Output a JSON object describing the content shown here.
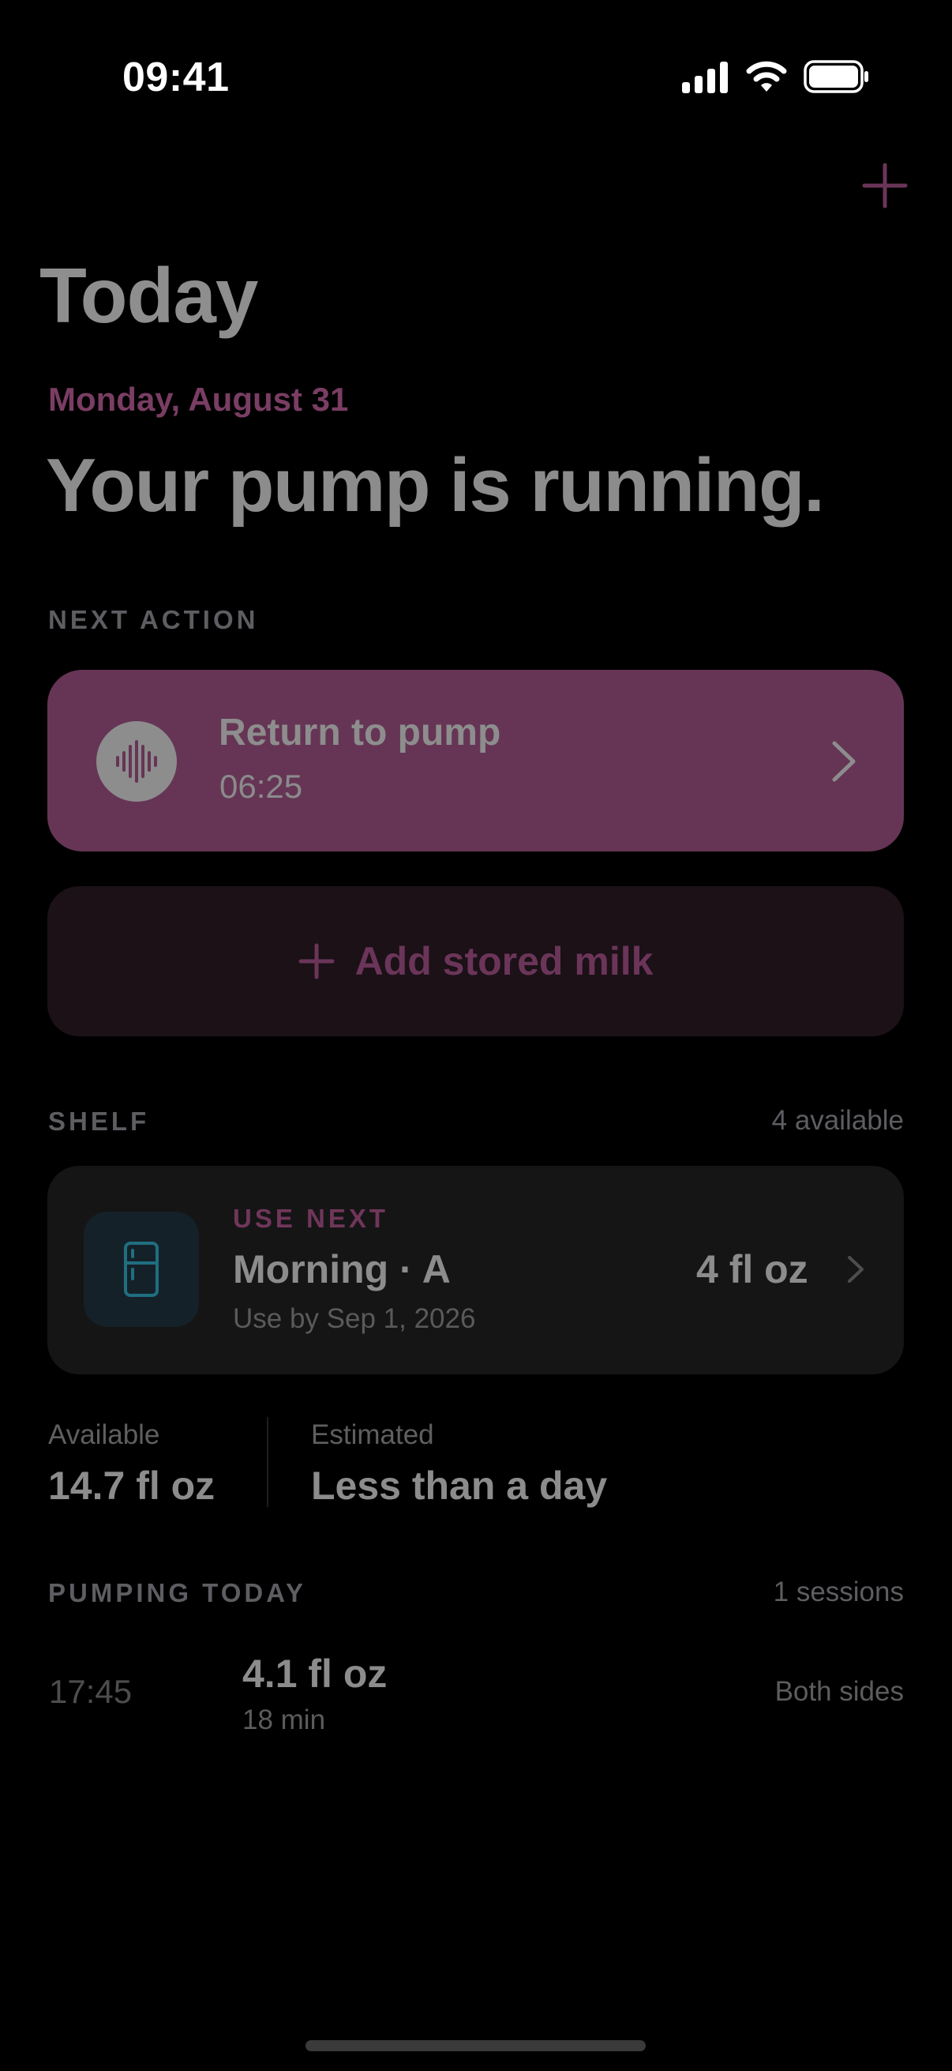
{
  "status_bar": {
    "time": "09:41",
    "icons": [
      "cellular-signal-icon",
      "wifi-icon",
      "battery-icon"
    ]
  },
  "nav": {
    "add_icon": "plus-icon",
    "large_title": "Today"
  },
  "header": {
    "date": "Monday, August 31",
    "headline": "Your pump is running."
  },
  "next_action": {
    "section_label": "NEXT ACTION",
    "card": {
      "icon": "waveform-icon",
      "title": "Return to pump",
      "subtitle": "06:25",
      "chevron": "chevron-right-icon"
    },
    "add_button": {
      "icon": "plus-icon",
      "label": "Add stored milk"
    }
  },
  "shelf": {
    "section_label": "SHELF",
    "count": "4 available",
    "item": {
      "icon": "refrigerator-icon",
      "badge": "USE NEXT",
      "title": "Morning · A",
      "subtitle": "Use by Sep 1, 2026",
      "amount": "4 fl oz",
      "chevron": "chevron-right-icon"
    }
  },
  "stats": {
    "available_label": "Available",
    "available_value": "14.7 fl oz",
    "estimated_label": "Estimated",
    "estimated_value": "Less than a day"
  },
  "pumping_today": {
    "section_label": "PUMPING TODAY",
    "count": "1 sessions",
    "sessions": [
      {
        "time": "17:45",
        "amount": "4.1 fl oz",
        "duration": "18 min",
        "side": "Both sides"
      }
    ]
  },
  "colors": {
    "background": "#000000",
    "accent": "#7a3d63",
    "action_card": "#663555",
    "add_button_bg": "#1b1117",
    "shelf_card_bg": "#151515"
  }
}
